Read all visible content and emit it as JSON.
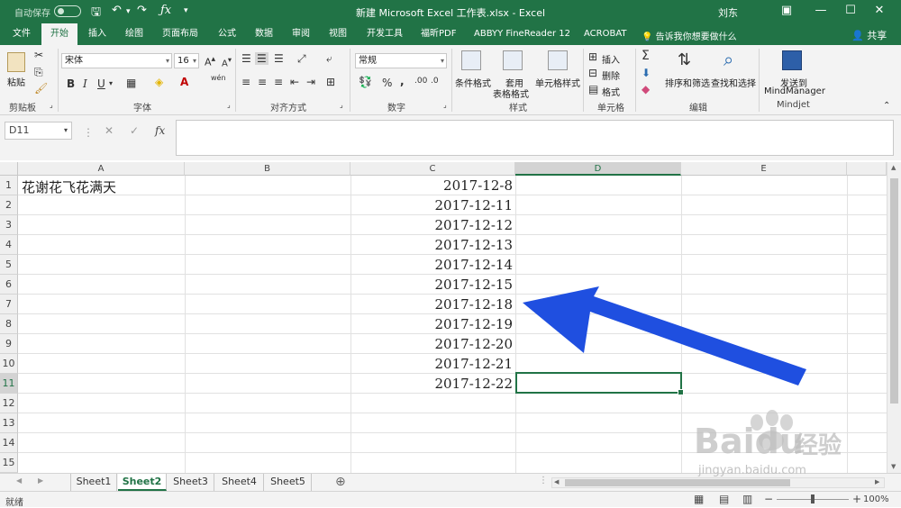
{
  "titlebar": {
    "autosave_label": "自动保存",
    "title": "新建 Microsoft Excel 工作表.xlsx - Excel",
    "user": "刘东",
    "icons": [
      "save-icon",
      "undo-icon",
      "redo-icon",
      "fx-icon",
      "customize-icon",
      "ribbon-display-icon",
      "minimize-icon",
      "maximize-icon",
      "close-icon"
    ],
    "accent": "#217346"
  },
  "tabs": [
    {
      "label": "文件"
    },
    {
      "label": "开始"
    },
    {
      "label": "插入"
    },
    {
      "label": "绘图"
    },
    {
      "label": "页面布局"
    },
    {
      "label": "公式"
    },
    {
      "label": "数据"
    },
    {
      "label": "审阅"
    },
    {
      "label": "视图"
    },
    {
      "label": "开发工具"
    },
    {
      "label": "福昕PDF"
    },
    {
      "label": "ABBYY FineReader 12"
    },
    {
      "label": "ACROBAT"
    }
  ],
  "tell_me": "告诉我你想要做什么",
  "share": "共享",
  "ribbon": {
    "paste_label": "粘贴",
    "clipboard_label": "剪贴板",
    "font_name": "宋体",
    "font_size": "16",
    "font_label": "字体",
    "bold": "B",
    "italic": "I",
    "underline": "U",
    "wen": "wén",
    "align_label": "对齐方式",
    "number_format": "常规",
    "number_label": "数字",
    "percent": "%",
    "comma": ",",
    "cond_format": "条件格式",
    "table_format_1": "套用",
    "table_format_2": "表格格式",
    "cell_style": "单元格样式",
    "styles_label": "样式",
    "insert": "插入",
    "delete": "删除",
    "format": "格式",
    "cells_label": "单元格",
    "sort_filter": "排序和筛选",
    "find_select": "查找和选择",
    "edit_label": "编辑",
    "send_to": "发送到",
    "mindmanager": "MindManager",
    "mindjet_label": "Mindjet"
  },
  "formula_bar": {
    "name_box": "D11",
    "fx": "fx",
    "cancel": "✕",
    "enter": "✓",
    "formula": ""
  },
  "columns": [
    "A",
    "B",
    "C",
    "D",
    "E"
  ],
  "rows": [
    "1",
    "2",
    "3",
    "4",
    "5",
    "6",
    "7",
    "8",
    "9",
    "10",
    "11",
    "12",
    "13",
    "14",
    "15"
  ],
  "cells": {
    "A1": "花谢花飞花满天",
    "C": [
      "2017-12-8",
      "2017-12-11",
      "2017-12-12",
      "2017-12-13",
      "2017-12-14",
      "2017-12-15",
      "2017-12-18",
      "2017-12-19",
      "2017-12-20",
      "2017-12-21",
      "2017-12-22"
    ]
  },
  "sheets": [
    {
      "label": "Sheet1"
    },
    {
      "label": "Sheet2"
    },
    {
      "label": "Sheet3"
    },
    {
      "label": "Sheet4"
    },
    {
      "label": "Sheet5"
    }
  ],
  "status": {
    "ready": "就绪",
    "zoom": "100%"
  },
  "watermark": {
    "brand": "Bai",
    "brand2": "du",
    "cn": "经验",
    "url": "jingyan.baidu.com"
  },
  "annotation_color": "#1f4fe0"
}
